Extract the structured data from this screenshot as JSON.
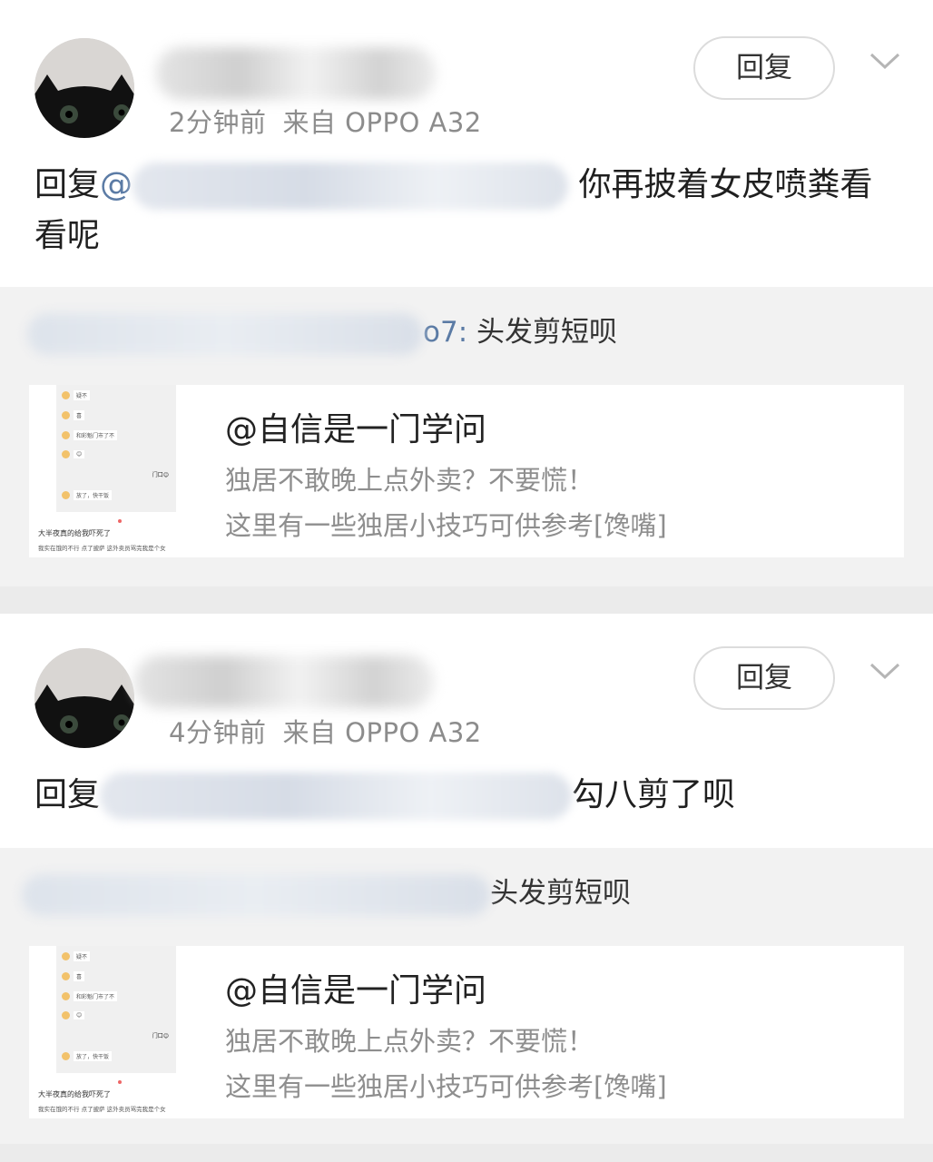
{
  "comments": [
    {
      "time": "2分钟前",
      "source": "来自 OPPO A32",
      "reply_label": "回复",
      "body_prefix": "回复",
      "mention_at": "@",
      "mention_tail": "",
      "body_text": "你再披着女皮喷粪看看呢",
      "quote": {
        "user_tail": "o7:",
        "text": "头发剪短呗",
        "card": {
          "title": "@自信是一门学问",
          "desc1": "独居不敢晚上点外卖？不要慌！",
          "desc2": "这里有一些独居小技巧可供参考[馋嘴]",
          "thumb_lines": [
            "疑不",
            "喜",
            "和彩魁门市了不",
            "😊",
            "放了，快干饭"
          ],
          "thumb_right": "门口😊",
          "thumb_caption1": "大半夜真的给我吓死了",
          "thumb_caption2": "我实在饿的不行 点了披萨 这外卖员骂完我是个女"
        }
      }
    },
    {
      "time": "4分钟前",
      "source": "来自 OPPO A32",
      "reply_label": "回复",
      "body_prefix": "回复",
      "mention_at": "",
      "mention_tail": "",
      "body_text": "勾八剪了呗",
      "quote": {
        "user_tail": "",
        "text": "头发剪短呗",
        "card": {
          "title": "@自信是一门学问",
          "desc1": "独居不敢晚上点外卖？不要慌！",
          "desc2": "这里有一些独居小技巧可供参考[馋嘴]",
          "thumb_lines": [
            "疑不",
            "喜",
            "和彩魁门市了不",
            "😊",
            "放了，快干饭"
          ],
          "thumb_right": "门口😊",
          "thumb_caption1": "大半夜真的给我吓死了",
          "thumb_caption2": "我实在饿的不行 点了披萨 这外卖员骂完我是个女"
        }
      }
    }
  ],
  "colors": {
    "link": "#5b7ba5",
    "meta": "#8c8c8c",
    "quote_bg": "#f2f2f2",
    "separator": "#ebebeb"
  },
  "icons": [
    "avatar-cat",
    "chevron-down-icon"
  ]
}
